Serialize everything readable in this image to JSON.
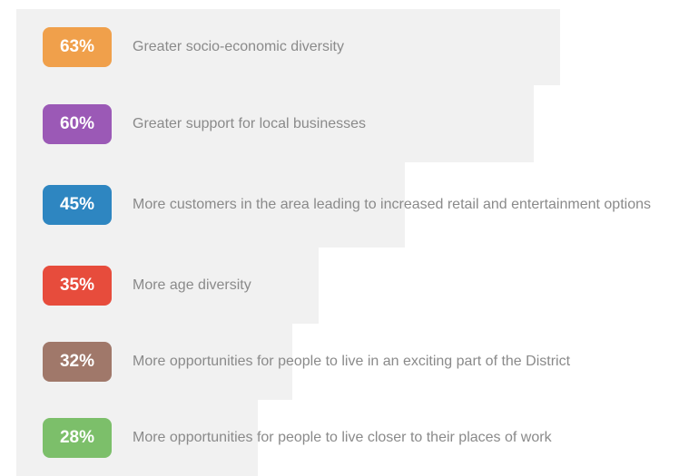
{
  "chart_data": {
    "type": "bar",
    "orientation": "horizontal",
    "unit": "%",
    "bars": [
      {
        "value": 63,
        "value_label": "63%",
        "label": "Greater socio-economic diversity",
        "color": "#f0a04b"
      },
      {
        "value": 60,
        "value_label": "60%",
        "label": "Greater support for local businesses",
        "color": "#9b59b6"
      },
      {
        "value": 45,
        "value_label": "45%",
        "label": "More customers in the area leading to increased retail and entertainment options",
        "color": "#2e86c1"
      },
      {
        "value": 35,
        "value_label": "35%",
        "label": "More age diversity",
        "color": "#e74c3c"
      },
      {
        "value": 32,
        "value_label": "32%",
        "label": "More opportunities for people to live in an exciting part of the District",
        "color": "#a0786a"
      },
      {
        "value": 28,
        "value_label": "28%",
        "label": "More opportunities for people to live closer to their places of work",
        "color": "#7cbf6a"
      }
    ],
    "bar_background": "#f1f1f1",
    "label_color": "#8a8a8a"
  }
}
